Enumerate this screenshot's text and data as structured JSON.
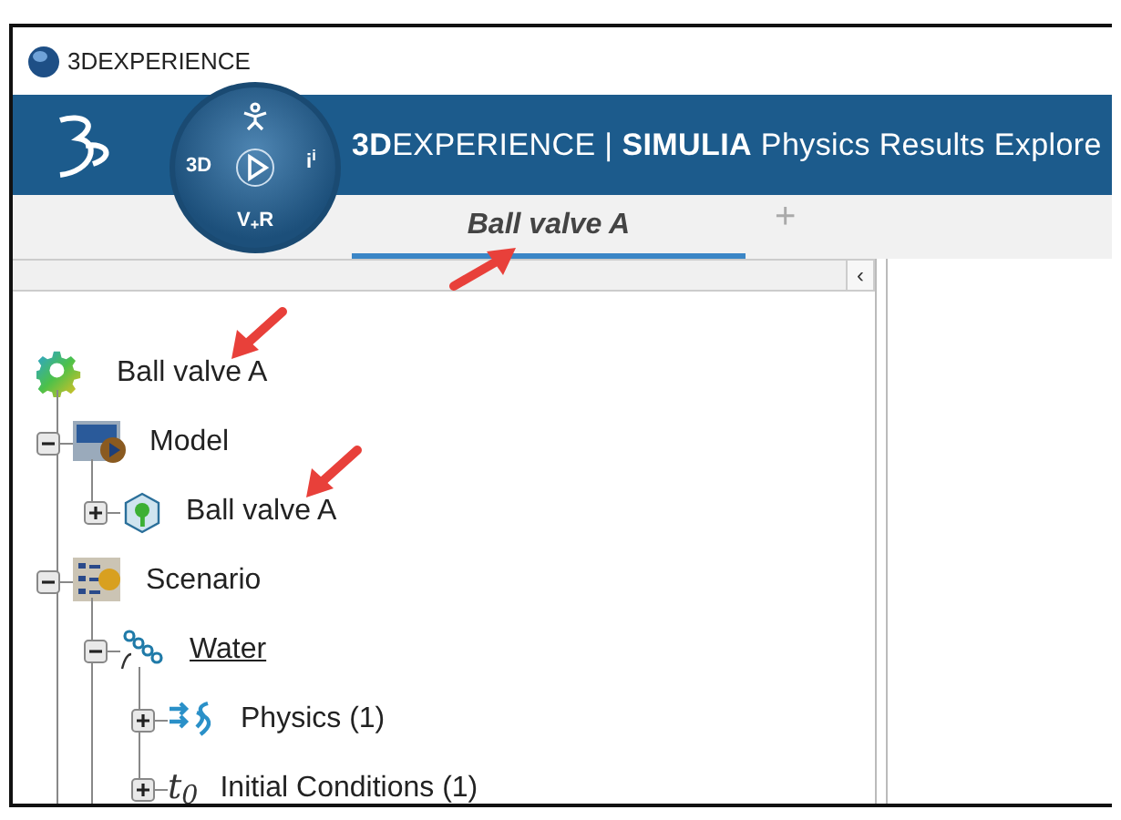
{
  "window": {
    "title": "3DEXPERIENCE"
  },
  "header": {
    "title": "**3D**EXPERIENCE | **SIMULIA** Physics Results Explore"
  },
  "compass": {
    "west": "3D",
    "east": "i$^{i}$",
    "south": "V$_{+}$R"
  },
  "tabs": [
    {
      "label": "Ball valve A",
      "selected": true,
      "arrow": true
    }
  ],
  "add_tab": "+",
  "panel_collapse": "‹",
  "tree": [
    {
      "label": "Ball valve A",
      "kind": "gear",
      "arrow": true,
      "children": [
        {
          "label": "Model",
          "kind": "model",
          "expanded": true,
          "children": [
            {
              "label": "Ball valve A",
              "kind": "part",
              "expanded": false,
              "arrow": true
            }
          ]
        },
        {
          "label": "Scenario",
          "kind": "scenario",
          "expanded": true,
          "children": [
            {
              "label": "Water",
              "kind": "material",
              "expanded": true,
              "underlined": true,
              "children": [
                {
                  "label": "Physics (1)",
                  "kind": "physics",
                  "expanded": false
                },
                {
                  "label": "Initial Conditions (1)",
                  "kind": "initial",
                  "icon_text": "t$_{0}$",
                  "expanded": false
                }
              ]
            }
          ]
        }
      ]
    }
  ]
}
